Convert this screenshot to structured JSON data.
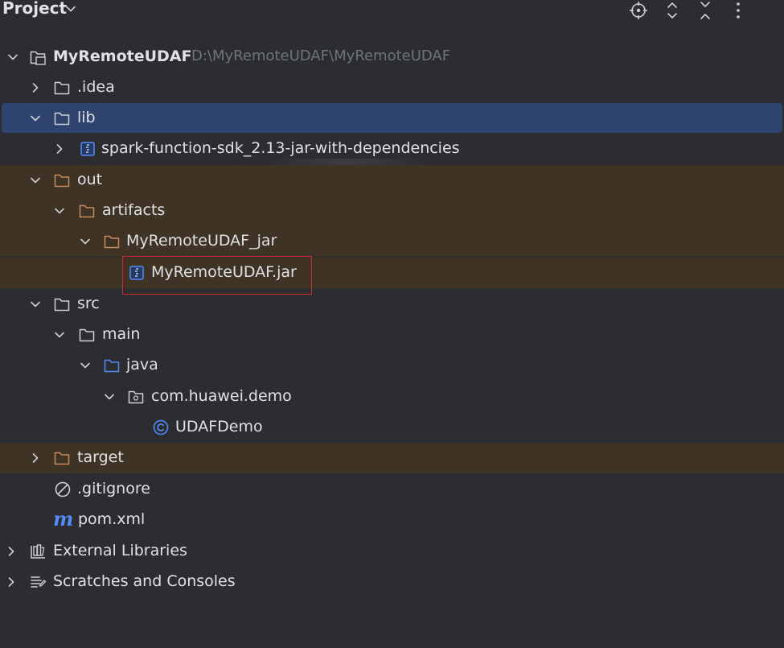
{
  "header": {
    "title": "Project",
    "icons": [
      "chevron-down-icon",
      "locate-icon",
      "expand-all-icon",
      "collapse-all-icon",
      "more-options-icon"
    ]
  },
  "tree": {
    "root": {
      "label": "MyRemoteUDAF",
      "path": "D:\\MyRemoteUDAF\\MyRemoteUDAF"
    },
    "idea": ".idea",
    "lib": "lib",
    "spark_sdk": "spark-function-sdk_2.13-jar-with-dependencies",
    "out": "out",
    "artifacts": "artifacts",
    "artifact_jar_dir": "MyRemoteUDAF_jar",
    "artifact_jar": "MyRemoteUDAF.jar",
    "src": "src",
    "main": "main",
    "java": "java",
    "package": "com.huawei.demo",
    "class": "UDAFDemo",
    "target": "target",
    "gitignore": ".gitignore",
    "pom": "pom.xml",
    "external_libraries": "External Libraries",
    "scratches": "Scratches and Consoles"
  },
  "colors": {
    "background": "#2b2d30",
    "selected": "#2e436e",
    "excluded": "#3e3325",
    "folder_excluded": "#c98a5e",
    "folder_source": "#548af7",
    "highlight_box": "#d12b30"
  }
}
